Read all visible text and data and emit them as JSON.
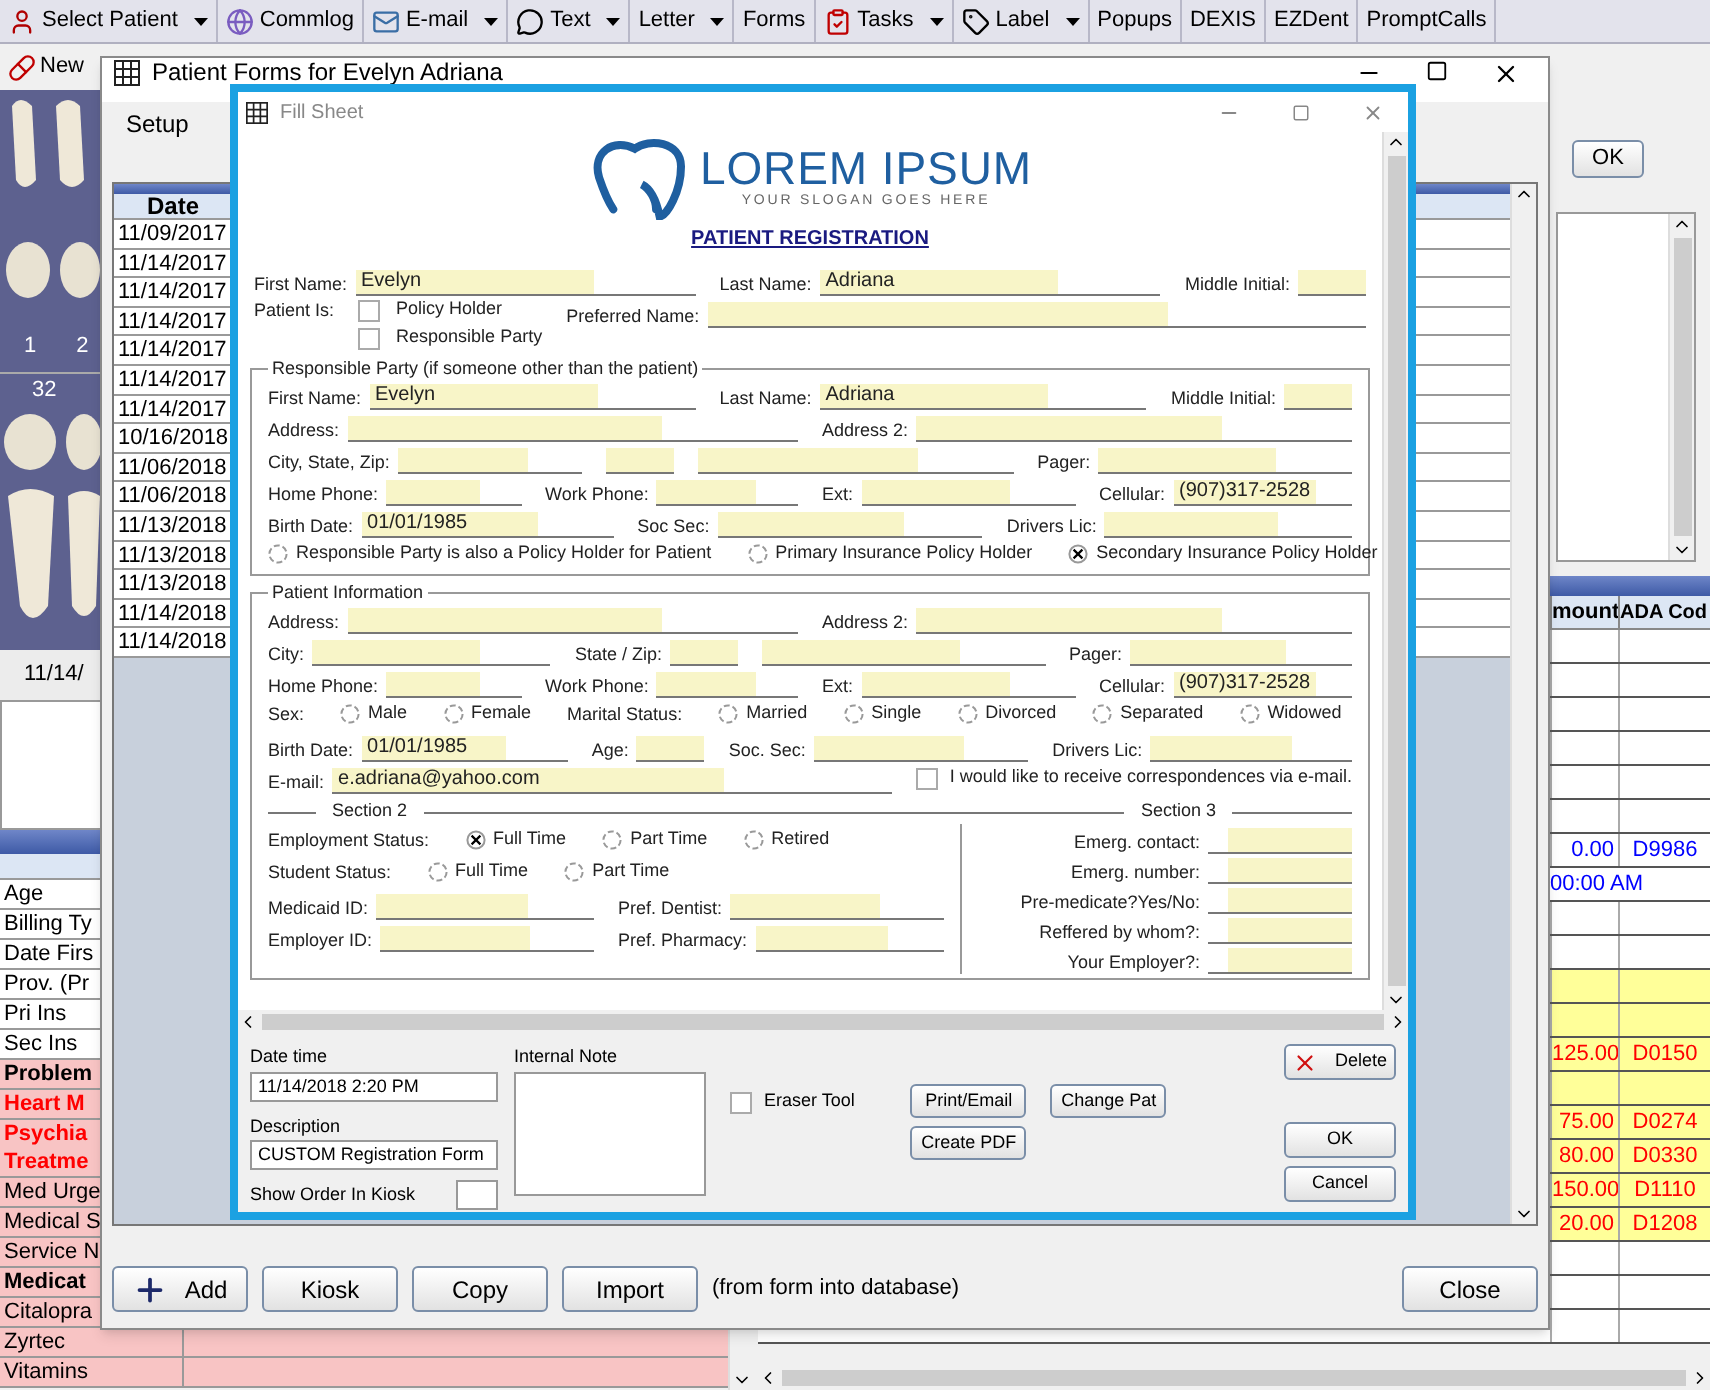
{
  "toolbar": [
    {
      "label": "Select Patient",
      "dropdown": true
    },
    {
      "label": "Commlog",
      "dropdown": false
    },
    {
      "label": "E-mail",
      "dropdown": true
    },
    {
      "label": "Text",
      "dropdown": true
    },
    {
      "label": "Letter",
      "dropdown": true
    },
    {
      "label": "Forms",
      "dropdown": false
    },
    {
      "label": "Tasks",
      "dropdown": true
    },
    {
      "label": "Label",
      "dropdown": true
    },
    {
      "label": "Popups",
      "dropdown": false
    },
    {
      "label": "DEXIS",
      "dropdown": false
    },
    {
      "label": "EZDent",
      "dropdown": false
    },
    {
      "label": "PromptCalls",
      "dropdown": false
    }
  ],
  "sub_toolbar": {
    "new_label": "New"
  },
  "tooth_chart": {
    "upper_numbers": [
      "1",
      "2"
    ],
    "lower_numbers": [
      "32"
    ]
  },
  "chart_date": "11/14/",
  "patient_info": {
    "rows": [
      {
        "label": "Age",
        "kind": "field"
      },
      {
        "label": "Billing Ty",
        "kind": "field"
      },
      {
        "label": "Date Firs",
        "kind": "field"
      },
      {
        "label": "Prov. (Pr",
        "kind": "field"
      },
      {
        "label": "Pri Ins",
        "kind": "field"
      },
      {
        "label": "Sec Ins",
        "kind": "field"
      },
      {
        "label": "Problem",
        "kind": "heading"
      },
      {
        "label": "Heart M",
        "kind": "alert"
      },
      {
        "label": "Psychia\nTreatme",
        "kind": "alert"
      },
      {
        "label": "Med Urge",
        "kind": "entry"
      },
      {
        "label": "Medical S",
        "kind": "entry"
      },
      {
        "label": "Service N",
        "kind": "entry"
      },
      {
        "label": "Medicat",
        "kind": "heading"
      },
      {
        "label": "Citalopra",
        "kind": "entry"
      },
      {
        "label": "Zyrtec",
        "kind": "entry"
      },
      {
        "label": "Vitamins",
        "kind": "entry"
      }
    ]
  },
  "right_panel": {
    "ok_label": "OK"
  },
  "procedures": {
    "columns": [
      "mount",
      "ADA Cod"
    ],
    "rows": [
      {
        "kind": "blank"
      },
      {
        "kind": "blank"
      },
      {
        "kind": "blank"
      },
      {
        "kind": "blank"
      },
      {
        "kind": "blank"
      },
      {
        "kind": "blank"
      },
      {
        "kind": "complete",
        "amount": "0.00",
        "code": "D9986"
      },
      {
        "kind": "note",
        "amount": "00:00 AM"
      },
      {
        "kind": "blank"
      },
      {
        "kind": "blank"
      },
      {
        "kind": "planned_blank"
      },
      {
        "kind": "planned_blank"
      },
      {
        "kind": "planned",
        "amount": "125.00",
        "code": "D0150"
      },
      {
        "kind": "planned_blank"
      },
      {
        "kind": "planned",
        "amount": "75.00",
        "code": "D0274"
      },
      {
        "kind": "planned",
        "amount": "80.00",
        "code": "D0330"
      },
      {
        "kind": "planned",
        "amount": "150.00",
        "code": "D1110"
      },
      {
        "kind": "planned",
        "amount": "20.00",
        "code": "D1208"
      },
      {
        "kind": "blank"
      },
      {
        "kind": "blank"
      },
      {
        "kind": "blank"
      }
    ]
  },
  "forms_window": {
    "title": "Patient Forms for Evelyn Adriana",
    "menu": [
      "Setup"
    ],
    "date_header": "Date",
    "dates": [
      "11/09/2017",
      "11/14/2017",
      "11/14/2017",
      "11/14/2017",
      "11/14/2017",
      "11/14/2017",
      "11/14/2017",
      "10/16/2018",
      "11/06/2018",
      "11/06/2018",
      "11/13/2018",
      "11/13/2018",
      "11/13/2018",
      "11/14/2018",
      "11/14/2018"
    ],
    "buttons": [
      {
        "label": "Add",
        "kind": "add"
      },
      {
        "label": "Kiosk",
        "kind": "plain"
      },
      {
        "label": "Copy",
        "kind": "plain"
      },
      {
        "label": "Import",
        "kind": "plain"
      }
    ],
    "note": "(from form into database)",
    "close_label": "Close"
  },
  "fill_sheet": {
    "title": "Fill Sheet",
    "brand": "LOREM IPSUM",
    "slogan": "YOUR SLOGAN GOES HERE",
    "heading": "PATIENT REGISTRATION",
    "patient_rows": [
      {
        "fields": [
          {
            "kind": "text",
            "label": "First Name:",
            "value": "Evelyn"
          },
          {
            "kind": "text",
            "label": "Last Name:",
            "value": "Adriana"
          },
          {
            "kind": "short",
            "label": "Middle Initial:"
          }
        ]
      },
      {
        "fields": [
          {
            "kind": "checks",
            "label": "Patient Is:",
            "options": [
              {
                "label": "Policy Holder",
                "checked": false
              },
              {
                "label": "Responsible Party",
                "checked": false
              }
            ]
          },
          {
            "kind": "text",
            "label": "Preferred Name:"
          }
        ]
      }
    ],
    "responsible": {
      "title": "Responsible Party (if someone other than the patient)",
      "rows": [
        {
          "fields": [
            {
              "kind": "text",
              "label": "First Name:",
              "value": "Evelyn"
            },
            {
              "kind": "text",
              "label": "Last Name:",
              "value": "Adriana"
            },
            {
              "kind": "short",
              "label": "Middle Initial:"
            }
          ]
        },
        {
          "fields": [
            {
              "kind": "text",
              "label": "Address:"
            },
            {
              "kind": "text",
              "label": "Address 2:"
            }
          ]
        },
        {
          "fields": [
            {
              "kind": "text",
              "label": "City, State, Zip:"
            },
            {
              "kind": "short"
            },
            {
              "kind": "text"
            },
            {
              "kind": "text",
              "label": "Pager:"
            }
          ]
        },
        {
          "fields": [
            {
              "kind": "text",
              "label": "Home Phone:"
            },
            {
              "kind": "text",
              "label": "Work Phone:"
            },
            {
              "kind": "text",
              "label": "Ext:"
            },
            {
              "kind": "text",
              "label": "Cellular:",
              "value": "(907)317-2528"
            }
          ]
        },
        {
          "fields": [
            {
              "kind": "text",
              "label": "Birth Date:",
              "value": "01/01/1985"
            },
            {
              "kind": "text",
              "label": "Soc Sec:"
            },
            {
              "kind": "text",
              "label": "Drivers Lic:"
            }
          ]
        },
        {
          "fields": [
            {
              "kind": "radio",
              "label": "Responsible Party is also a Policy Holder for Patient",
              "selected": false
            },
            {
              "kind": "radio",
              "label": "Primary Insurance Policy Holder",
              "selected": false
            },
            {
              "kind": "radio",
              "label": "Secondary Insurance Policy Holder",
              "selected": true
            }
          ]
        }
      ]
    },
    "patient_info": {
      "title": "Patient Information",
      "rows": [
        {
          "fields": [
            {
              "kind": "text",
              "label": "Address:"
            },
            {
              "kind": "text",
              "label": "Address 2:"
            }
          ]
        },
        {
          "fields": [
            {
              "kind": "text",
              "label": "City:"
            },
            {
              "kind": "short",
              "label": "State / Zip:"
            },
            {
              "kind": "text"
            },
            {
              "kind": "text",
              "label": "Pager:"
            }
          ]
        },
        {
          "fields": [
            {
              "kind": "text",
              "label": "Home Phone:"
            },
            {
              "kind": "text",
              "label": "Work Phone:"
            },
            {
              "kind": "text",
              "label": "Ext:"
            },
            {
              "kind": "text",
              "label": "Cellular:",
              "value": "(907)317-2528"
            }
          ]
        },
        {
          "fields": [
            {
              "kind": "label",
              "label": "Sex:"
            },
            {
              "kind": "radio",
              "label": "Male",
              "selected": false
            },
            {
              "kind": "radio",
              "label": "Female",
              "selected": false
            },
            {
              "kind": "label",
              "label": "Marital Status:"
            },
            {
              "kind": "radio",
              "label": "Married",
              "selected": false
            },
            {
              "kind": "radio",
              "label": "Single",
              "selected": false
            },
            {
              "kind": "radio",
              "label": "Divorced",
              "selected": false
            },
            {
              "kind": "radio",
              "label": "Separated",
              "selected": false
            },
            {
              "kind": "radio",
              "label": "Widowed",
              "selected": false
            }
          ]
        },
        {
          "fields": [
            {
              "kind": "text",
              "label": "Birth Date:",
              "value": "01/01/1985"
            },
            {
              "kind": "short",
              "label": "Age:"
            },
            {
              "kind": "text",
              "label": "Soc. Sec:"
            },
            {
              "kind": "text",
              "label": "Drivers Lic:"
            }
          ]
        },
        {
          "fields": [
            {
              "kind": "text",
              "label": "E-mail:",
              "value": "e.adriana@yahoo.com"
            },
            {
              "kind": "check",
              "label": "I would like to receive correspondences via e-mail.",
              "checked": false
            }
          ]
        }
      ]
    },
    "section2": {
      "title": "Section 2",
      "rows": [
        {
          "fields": [
            {
              "kind": "label",
              "label": "Employment Status:"
            },
            {
              "kind": "radio",
              "label": "Full Time",
              "selected": true
            },
            {
              "kind": "radio",
              "label": "Part Time",
              "selected": false
            },
            {
              "kind": "radio",
              "label": "Retired",
              "selected": false
            }
          ]
        },
        {
          "fields": [
            {
              "kind": "label",
              "label": "Student Status:"
            },
            {
              "kind": "radio",
              "label": "Full Time",
              "selected": false
            },
            {
              "kind": "radio",
              "label": "Part Time",
              "selected": false
            }
          ]
        },
        {
          "fields": [
            {
              "kind": "text",
              "label": "Medicaid ID:"
            },
            {
              "kind": "text",
              "label": "Pref. Dentist:"
            }
          ]
        },
        {
          "fields": [
            {
              "kind": "text",
              "label": "Employer ID:"
            },
            {
              "kind": "text",
              "label": "Pref. Pharmacy:"
            }
          ]
        }
      ]
    },
    "section3": {
      "title": "Section 3",
      "fields": [
        "Emerg. contact:",
        "Emerg. number:",
        "Pre-medicate?Yes/No:",
        "Reffered by whom?:",
        "Your Employer?:"
      ]
    },
    "bottom": {
      "date_label": "Date time",
      "date_value": "11/14/2018 2:20 PM",
      "description_label": "Description",
      "description_value": "CUSTOM Registration Form",
      "kiosk_label": "Show Order In Kiosk",
      "note_label": "Internal Note",
      "eraser": {
        "label": "Eraser Tool",
        "checked": false
      },
      "print_label": "Print/Email",
      "change_label": "Change Pat",
      "pdf_label": "Create PDF",
      "delete_label": "Delete",
      "ok_label": "OK",
      "cancel_label": "Cancel"
    }
  }
}
